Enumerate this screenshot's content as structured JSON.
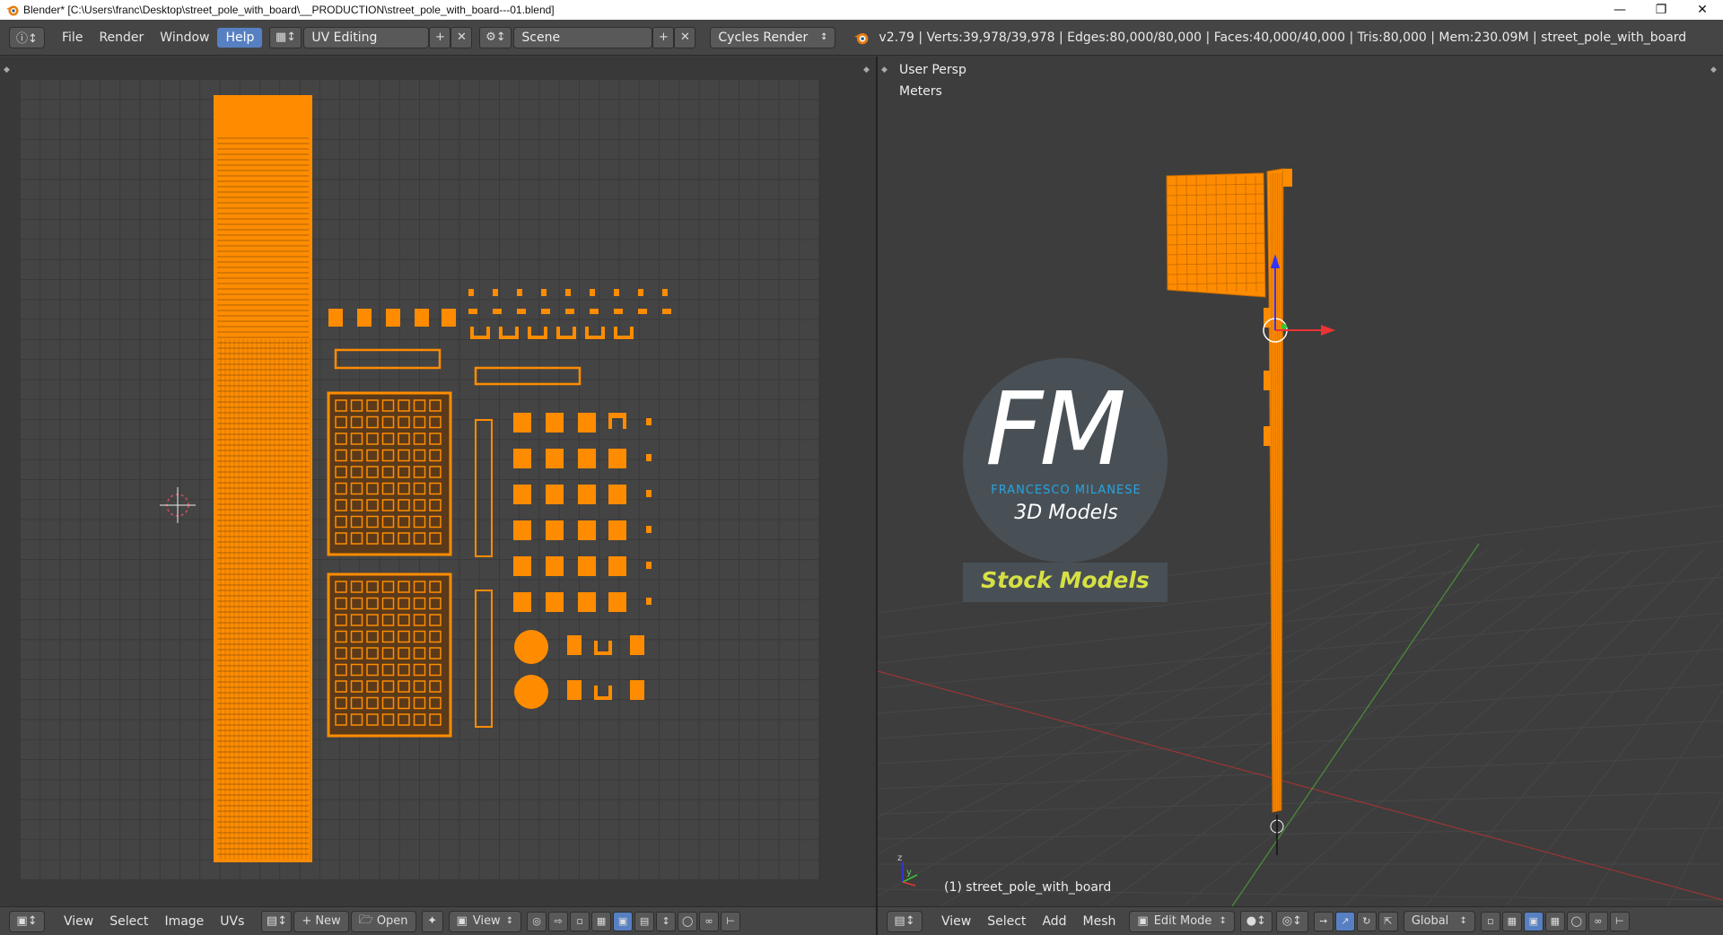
{
  "window": {
    "title": "Blender* [C:\\Users\\franc\\Desktop\\street_pole_with_board\\__PRODUCTION\\street_pole_with_board---01.blend]",
    "controls": [
      "minimize",
      "restore",
      "close"
    ]
  },
  "info_header": {
    "menus": [
      "File",
      "Render",
      "Window",
      "Help"
    ],
    "active_menu": "Help",
    "screen_layout": "UV Editing",
    "scene": "Scene",
    "render_engine": "Cycles Render",
    "stats": "v2.79 | Verts:39,978/39,978 | Edges:80,000/80,000 | Faces:40,000/40,000 | Tris:80,000 | Mem:230.09M | street_pole_with_board"
  },
  "uv_editor": {
    "footer_menus": [
      "View",
      "Select",
      "Image",
      "UVs"
    ],
    "new_label": "New",
    "open_label": "Open",
    "view_label": "View"
  },
  "viewport": {
    "view_name": "User Persp",
    "units": "Meters",
    "object_label": "(1) street_pole_with_board",
    "footer_menus": [
      "View",
      "Select",
      "Add",
      "Mesh"
    ],
    "mode": "Edit Mode",
    "orientation": "Global",
    "axis_labels": {
      "y": "y",
      "z": "z"
    }
  },
  "watermark": {
    "logo_letters": "FM",
    "brand": "FRANCESCO MILANESE",
    "tagline": "3D Models",
    "stock": "Stock Models"
  },
  "colors": {
    "uv_orange": "#ff8c00",
    "accent_blue": "#5680c2",
    "watermark_blue": "#29a3e0",
    "watermark_yellow": "#d7e043"
  }
}
